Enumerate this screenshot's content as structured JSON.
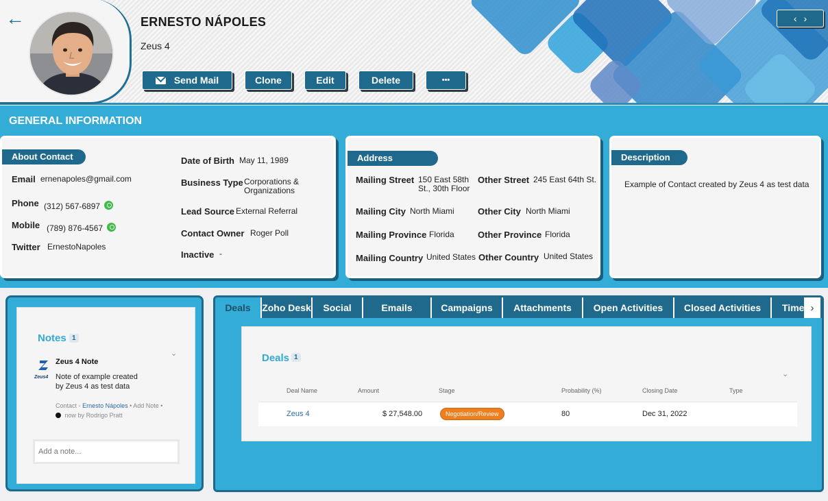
{
  "header": {
    "name": "ERNESTO NÁPOLES",
    "company": "Zeus 4",
    "buttons": {
      "send_mail": "Send Mail",
      "clone": "Clone",
      "edit": "Edit",
      "delete": "Delete",
      "more": "•••"
    },
    "nav": {
      "prev": "‹",
      "next": "›"
    },
    "back": "←"
  },
  "general": {
    "title": "GENERAL INFORMATION",
    "about": {
      "tag": "About Contact",
      "email_label": "Email",
      "email": "ernenapoles@gmail.com",
      "phone_label": "Phone",
      "phone": "(312) 567-6897",
      "mobile_label": "Mobile",
      "mobile": "(789) 876-4567",
      "twitter_label": "Twitter",
      "twitter": "ErnestoNapoles",
      "dob_label": "Date of Birth",
      "dob": "May 11, 1989",
      "business_type_label": "Business Type",
      "business_type_line1": "Corporations &",
      "business_type_line2": "Organizations",
      "lead_source_label": "Lead Source",
      "lead_source": "External Referral",
      "owner_label": "Contact Owner",
      "owner": "Roger Poll",
      "inactive_label": "Inactive",
      "inactive": "-"
    },
    "address": {
      "tag": "Address",
      "mailing_street_label": "Mailing Street",
      "mailing_street_line1": "150 East 58th",
      "mailing_street_line2": "St., 30th Floor",
      "other_street_label": "Other Street",
      "other_street": "245 East 64th St.",
      "mailing_city_label": "Mailing City",
      "mailing_city": "North Miami",
      "other_city_label": "Other City",
      "other_city": "North Miami",
      "mailing_province_label": "Mailing Province",
      "mailing_province": "Florida",
      "other_province_label": "Other Province",
      "other_province": "Florida",
      "mailing_country_label": "Mailing Country",
      "mailing_country": "United States",
      "other_country_label": "Other Country",
      "other_country": "United States"
    },
    "description": {
      "tag": "Description",
      "text": "Example of Contact created by Zeus 4 as test data"
    }
  },
  "notes": {
    "title": "Notes",
    "count": "1",
    "logo_text": "Zeus4",
    "note_title": "Zeus 4 Note",
    "note_line1": "Note of example created",
    "note_line2": "by Zeus 4 as test data",
    "meta_contact": "Contact",
    "meta_dash": "-",
    "meta_name": "Ernesto Nápoles",
    "meta_add": "• Add Note •",
    "meta_time": "now by",
    "meta_author": "Rodrigo Pratt",
    "input_placeholder": "Add a note..."
  },
  "tabs": [
    "Deals",
    "Zoho Desk",
    "Social",
    "Emails",
    "Campaigns",
    "Attachments",
    "Open Activities",
    "Closed Activities",
    "Time"
  ],
  "deals": {
    "title": "Deals",
    "count": "1",
    "columns": [
      "Deal Name",
      "Amount",
      "Stage",
      "Probability (%)",
      "Closing Date",
      "Type"
    ],
    "rows": [
      {
        "name": "Zeus 4",
        "amount": "$ 27,548.00",
        "stage": "Negotiation/Review",
        "probability": "80",
        "closing_date": "Dec 31, 2022",
        "type": ""
      }
    ]
  },
  "colors": {
    "primary": "#1f6a8c",
    "accent": "#33add8",
    "stage_badge": "#ef7e1c",
    "whatsapp": "#3cbd45"
  }
}
